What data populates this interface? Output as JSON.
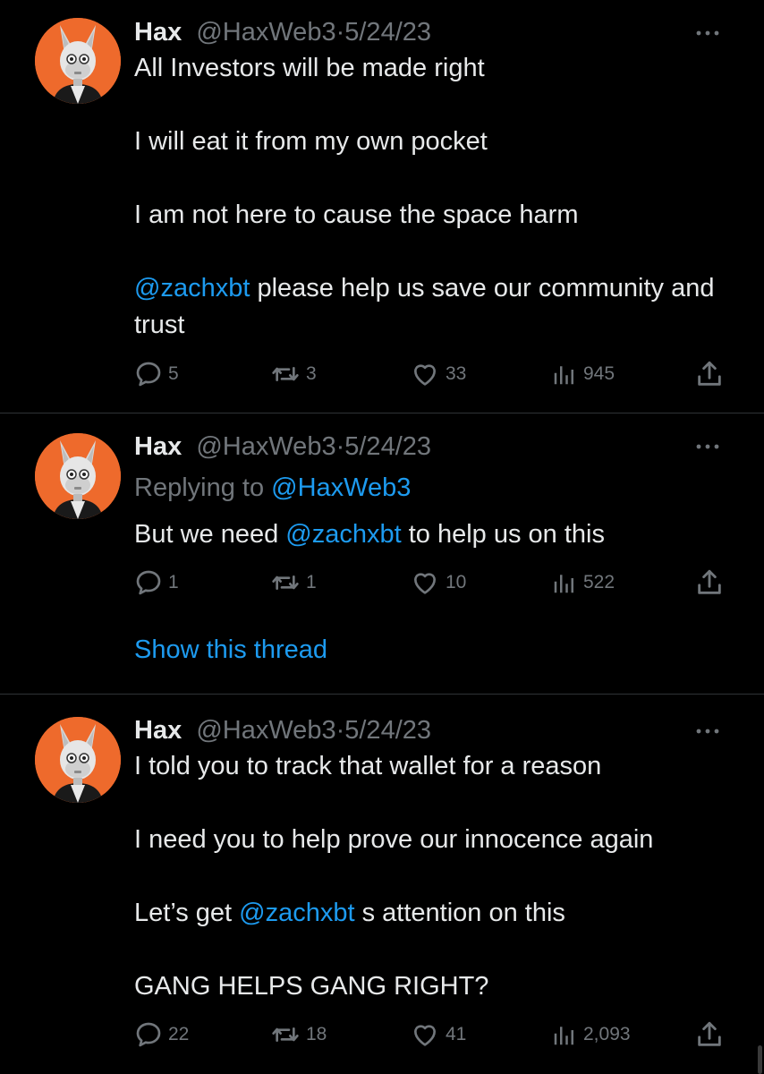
{
  "tweets": [
    {
      "name": "Hax",
      "handle": "@HaxWeb3",
      "separator": "·",
      "date": "5/24/23",
      "lines": {
        "l1": "All Investors will be made right",
        "l2": "I will eat it from my own pocket",
        "l3": "I am not here to cause the space harm",
        "l4_mention": "@zachxbt",
        "l4_rest": " please help us save our community and trust"
      },
      "stats": {
        "replies": "5",
        "retweets": "3",
        "likes": "33",
        "views": "945"
      }
    },
    {
      "name": "Hax",
      "handle": "@HaxWeb3",
      "separator": "·",
      "date": "5/24/23",
      "replying_label": "Replying to ",
      "replying_handle": "@HaxWeb3",
      "lines": {
        "pre": "But we need ",
        "mention": "@zachxbt",
        "post": " to help us on this"
      },
      "stats": {
        "replies": "1",
        "retweets": "1",
        "likes": "10",
        "views": "522"
      },
      "thread_link": "Show this thread"
    },
    {
      "name": "Hax",
      "handle": "@HaxWeb3",
      "separator": "·",
      "date": "5/24/23",
      "lines": {
        "l1": "I told you to track that wallet for a reason",
        "l2": "I need you to help prove our innocence again",
        "l3_pre": "Let’s get ",
        "l3_mention": "@zachxbt",
        "l3_post": " s attention on this",
        "l4": "GANG HELPS GANG RIGHT?"
      },
      "stats": {
        "replies": "22",
        "retweets": "18",
        "likes": "41",
        "views": "2,093"
      }
    }
  ],
  "icons": {
    "reply": "reply-icon",
    "retweet": "retweet-icon",
    "like": "heart-icon",
    "views": "views-icon",
    "share": "share-icon",
    "more": "more-icon"
  },
  "colors": {
    "background": "#000000",
    "text": "#e7e9ea",
    "muted": "#71767b",
    "accent": "#1d9bf0",
    "avatar_bg": "#ee6a2c",
    "divider": "#2f3336"
  }
}
